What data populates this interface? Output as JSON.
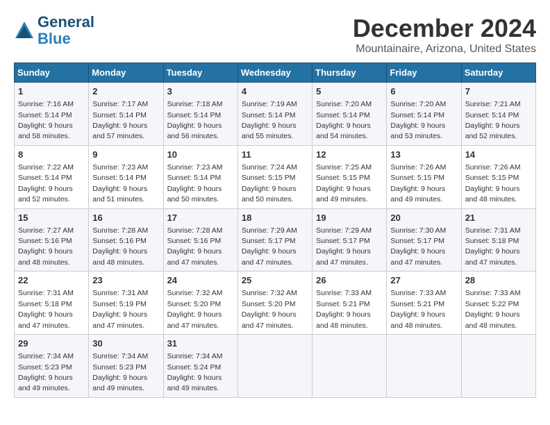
{
  "header": {
    "logo_line1": "General",
    "logo_line2": "Blue",
    "title": "December 2024",
    "subtitle": "Mountainaire, Arizona, United States"
  },
  "weekdays": [
    "Sunday",
    "Monday",
    "Tuesday",
    "Wednesday",
    "Thursday",
    "Friday",
    "Saturday"
  ],
  "weeks": [
    [
      {
        "day": "1",
        "info": "Sunrise: 7:16 AM\nSunset: 5:14 PM\nDaylight: 9 hours\nand 58 minutes."
      },
      {
        "day": "2",
        "info": "Sunrise: 7:17 AM\nSunset: 5:14 PM\nDaylight: 9 hours\nand 57 minutes."
      },
      {
        "day": "3",
        "info": "Sunrise: 7:18 AM\nSunset: 5:14 PM\nDaylight: 9 hours\nand 56 minutes."
      },
      {
        "day": "4",
        "info": "Sunrise: 7:19 AM\nSunset: 5:14 PM\nDaylight: 9 hours\nand 55 minutes."
      },
      {
        "day": "5",
        "info": "Sunrise: 7:20 AM\nSunset: 5:14 PM\nDaylight: 9 hours\nand 54 minutes."
      },
      {
        "day": "6",
        "info": "Sunrise: 7:20 AM\nSunset: 5:14 PM\nDaylight: 9 hours\nand 53 minutes."
      },
      {
        "day": "7",
        "info": "Sunrise: 7:21 AM\nSunset: 5:14 PM\nDaylight: 9 hours\nand 52 minutes."
      }
    ],
    [
      {
        "day": "8",
        "info": "Sunrise: 7:22 AM\nSunset: 5:14 PM\nDaylight: 9 hours\nand 52 minutes."
      },
      {
        "day": "9",
        "info": "Sunrise: 7:23 AM\nSunset: 5:14 PM\nDaylight: 9 hours\nand 51 minutes."
      },
      {
        "day": "10",
        "info": "Sunrise: 7:23 AM\nSunset: 5:14 PM\nDaylight: 9 hours\nand 50 minutes."
      },
      {
        "day": "11",
        "info": "Sunrise: 7:24 AM\nSunset: 5:15 PM\nDaylight: 9 hours\nand 50 minutes."
      },
      {
        "day": "12",
        "info": "Sunrise: 7:25 AM\nSunset: 5:15 PM\nDaylight: 9 hours\nand 49 minutes."
      },
      {
        "day": "13",
        "info": "Sunrise: 7:26 AM\nSunset: 5:15 PM\nDaylight: 9 hours\nand 49 minutes."
      },
      {
        "day": "14",
        "info": "Sunrise: 7:26 AM\nSunset: 5:15 PM\nDaylight: 9 hours\nand 48 minutes."
      }
    ],
    [
      {
        "day": "15",
        "info": "Sunrise: 7:27 AM\nSunset: 5:16 PM\nDaylight: 9 hours\nand 48 minutes."
      },
      {
        "day": "16",
        "info": "Sunrise: 7:28 AM\nSunset: 5:16 PM\nDaylight: 9 hours\nand 48 minutes."
      },
      {
        "day": "17",
        "info": "Sunrise: 7:28 AM\nSunset: 5:16 PM\nDaylight: 9 hours\nand 47 minutes."
      },
      {
        "day": "18",
        "info": "Sunrise: 7:29 AM\nSunset: 5:17 PM\nDaylight: 9 hours\nand 47 minutes."
      },
      {
        "day": "19",
        "info": "Sunrise: 7:29 AM\nSunset: 5:17 PM\nDaylight: 9 hours\nand 47 minutes."
      },
      {
        "day": "20",
        "info": "Sunrise: 7:30 AM\nSunset: 5:17 PM\nDaylight: 9 hours\nand 47 minutes."
      },
      {
        "day": "21",
        "info": "Sunrise: 7:31 AM\nSunset: 5:18 PM\nDaylight: 9 hours\nand 47 minutes."
      }
    ],
    [
      {
        "day": "22",
        "info": "Sunrise: 7:31 AM\nSunset: 5:18 PM\nDaylight: 9 hours\nand 47 minutes."
      },
      {
        "day": "23",
        "info": "Sunrise: 7:31 AM\nSunset: 5:19 PM\nDaylight: 9 hours\nand 47 minutes."
      },
      {
        "day": "24",
        "info": "Sunrise: 7:32 AM\nSunset: 5:20 PM\nDaylight: 9 hours\nand 47 minutes."
      },
      {
        "day": "25",
        "info": "Sunrise: 7:32 AM\nSunset: 5:20 PM\nDaylight: 9 hours\nand 47 minutes."
      },
      {
        "day": "26",
        "info": "Sunrise: 7:33 AM\nSunset: 5:21 PM\nDaylight: 9 hours\nand 48 minutes."
      },
      {
        "day": "27",
        "info": "Sunrise: 7:33 AM\nSunset: 5:21 PM\nDaylight: 9 hours\nand 48 minutes."
      },
      {
        "day": "28",
        "info": "Sunrise: 7:33 AM\nSunset: 5:22 PM\nDaylight: 9 hours\nand 48 minutes."
      }
    ],
    [
      {
        "day": "29",
        "info": "Sunrise: 7:34 AM\nSunset: 5:23 PM\nDaylight: 9 hours\nand 49 minutes."
      },
      {
        "day": "30",
        "info": "Sunrise: 7:34 AM\nSunset: 5:23 PM\nDaylight: 9 hours\nand 49 minutes."
      },
      {
        "day": "31",
        "info": "Sunrise: 7:34 AM\nSunset: 5:24 PM\nDaylight: 9 hours\nand 49 minutes."
      },
      null,
      null,
      null,
      null
    ]
  ]
}
